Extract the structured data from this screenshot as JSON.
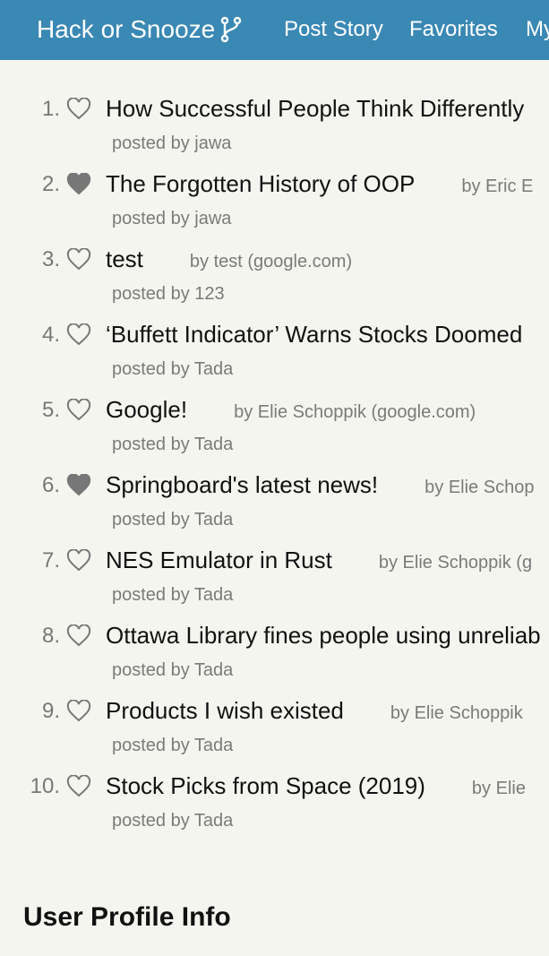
{
  "nav": {
    "brand": "Hack or Snooze",
    "links": [
      "Post Story",
      "Favorites",
      "My"
    ]
  },
  "stories": [
    {
      "num": "1.",
      "favorite": false,
      "title": "How Successful People Think Differently",
      "author": "",
      "user": "posted by jawa"
    },
    {
      "num": "2.",
      "favorite": true,
      "title": "The Forgotten History of OOP",
      "author": "by Eric E",
      "user": "posted by jawa"
    },
    {
      "num": "3.",
      "favorite": false,
      "title": "test",
      "author": "by test (google.com)",
      "user": "posted by 123"
    },
    {
      "num": "4.",
      "favorite": false,
      "title": "‘Buffett Indicator’ Warns Stocks Doomed",
      "author": "",
      "user": "posted by Tada"
    },
    {
      "num": "5.",
      "favorite": false,
      "title": "Google!",
      "author": "by Elie Schoppik (google.com)",
      "user": "posted by Tada"
    },
    {
      "num": "6.",
      "favorite": true,
      "title": "Springboard's latest news!",
      "author": "by Elie Schop",
      "user": "posted by Tada"
    },
    {
      "num": "7.",
      "favorite": false,
      "title": "NES Emulator in Rust",
      "author": "by Elie Schoppik (g",
      "user": "posted by Tada"
    },
    {
      "num": "8.",
      "favorite": false,
      "title": "Ottawa Library fines people using unreliab",
      "author": "",
      "user": "posted by Tada"
    },
    {
      "num": "9.",
      "favorite": false,
      "title": "Products I wish existed",
      "author": "by Elie Schoppik",
      "user": "posted by Tada"
    },
    {
      "num": "10.",
      "favorite": false,
      "title": "Stock Picks from Space (2019)",
      "author": "by Elie",
      "user": "posted by Tada"
    }
  ],
  "profile": {
    "heading": "User Profile Info"
  },
  "colors": {
    "navbar": "#3a88b4",
    "background": "#f5f5f0",
    "heart": "#777777"
  }
}
